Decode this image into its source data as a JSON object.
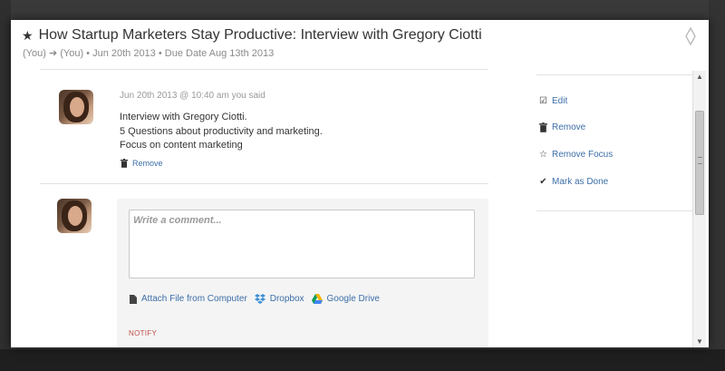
{
  "task": {
    "title": "How Startup Marketers Stay Productive: Interview with Gregory Ciotti",
    "subtitle": "(You) ➔ (You) • Jun 20th 2013 • Due Date Aug 13th 2013"
  },
  "comment": {
    "meta": "Jun 20th 2013 @ 10:40 am you said",
    "lines": [
      "Interview with Gregory Ciotti.",
      "5 Questions about productivity and marketing.",
      "Focus on content marketing"
    ],
    "remove_label": "Remove"
  },
  "new_comment": {
    "placeholder": "Write a comment...",
    "attach_computer": "Attach File from Computer",
    "dropbox": "Dropbox",
    "google_drive": "Google Drive",
    "notify_label": "NOTIFY"
  },
  "actions": {
    "edit": "Edit",
    "remove": "Remove",
    "remove_focus": "Remove Focus",
    "mark_done": "Mark as Done"
  },
  "colors": {
    "link": "#3c6ea8",
    "notify": "#c0504d"
  }
}
